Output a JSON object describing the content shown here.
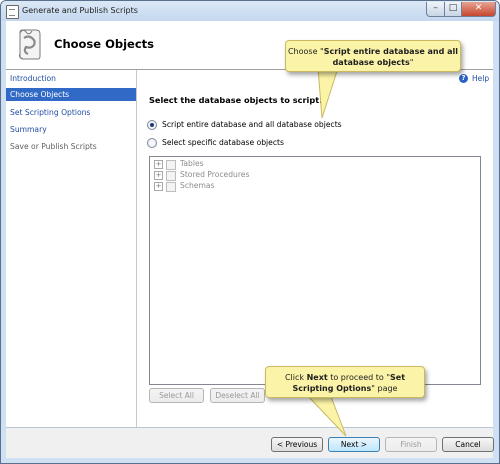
{
  "window": {
    "title": "Generate and Publish Scripts",
    "controls": {
      "minimize": "–",
      "maximize": "□",
      "close": "✕"
    }
  },
  "header": {
    "title": "Choose Objects",
    "icon": "scroll-script-icon"
  },
  "sidebar": {
    "items": [
      {
        "label": "Introduction",
        "state": "link"
      },
      {
        "label": "Choose Objects",
        "state": "selected"
      },
      {
        "label": "Set Scripting Options",
        "state": "link"
      },
      {
        "label": "Summary",
        "state": "link"
      },
      {
        "label": "Save or Publish Scripts",
        "state": "disabled"
      }
    ]
  },
  "main": {
    "help_label": "Help",
    "help_icon": "?",
    "instruction": "Select the database objects to script.",
    "options": [
      {
        "label": "Script entire database and all database objects",
        "checked": true
      },
      {
        "label": "Select specific database objects",
        "checked": false
      }
    ],
    "tree": [
      {
        "label": "Tables",
        "expander": "+"
      },
      {
        "label": "Stored Procedures",
        "expander": "+"
      },
      {
        "label": "Schemas",
        "expander": "+"
      }
    ],
    "select_all_label": "Select All",
    "deselect_all_label": "Deselect All"
  },
  "footer": {
    "previous_label": "< Previous",
    "next_label": "Next >",
    "finish_label": "Finish",
    "cancel_label": "Cancel"
  },
  "callouts": {
    "top": {
      "prefix": "Choose \"",
      "bold": "Script entire database and all database objects",
      "suffix": "\""
    },
    "bottom": {
      "prefix": "Click ",
      "bold1": "Next",
      "middle": " to proceed to \"",
      "bold2": "Set Scripting Options",
      "suffix": "\" page"
    }
  },
  "colors": {
    "selection": "#3169c6",
    "link": "#1f4da6",
    "callout_bg": "#fbf4a8",
    "window_frame": "#cfe0f3"
  }
}
